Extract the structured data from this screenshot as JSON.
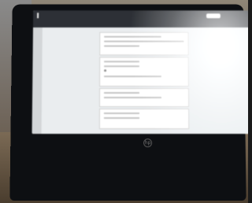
{
  "scene": {
    "description_type": "photo of laptop displaying a web form"
  },
  "screen": {
    "topbar": {
      "title": "",
      "subtitle": "",
      "tabs": [
        "",
        ""
      ]
    }
  },
  "colors": {
    "bezel": "#0d0f12",
    "screen_bg": "#dfe2e4",
    "topbar": "#2b2e33"
  }
}
